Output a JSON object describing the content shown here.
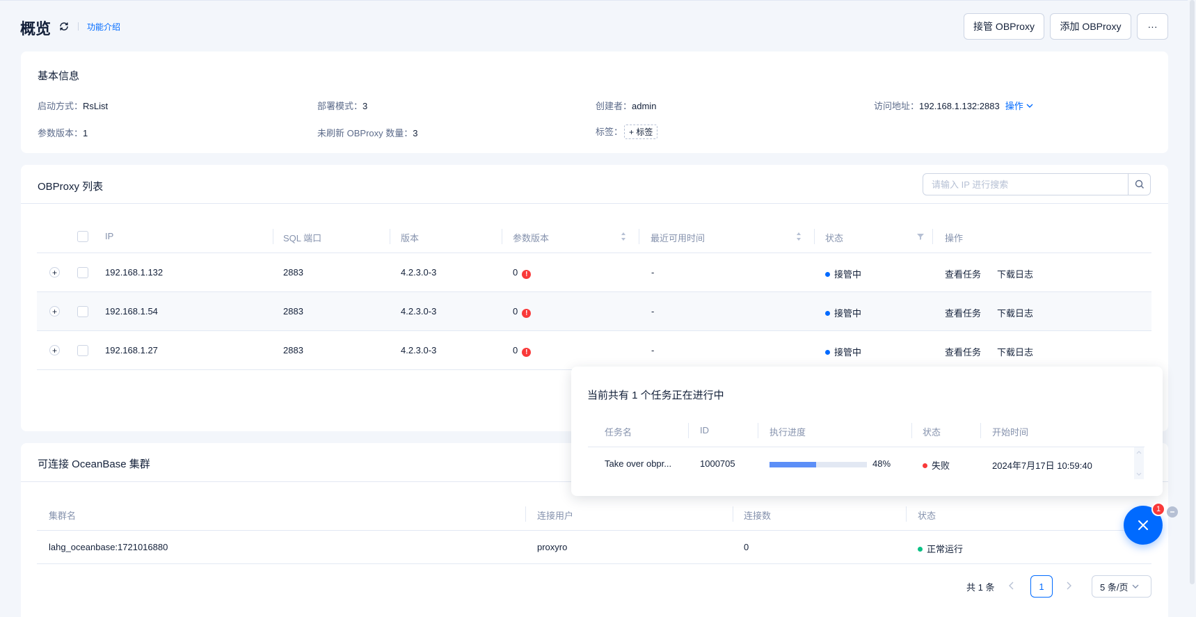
{
  "header": {
    "title": "概览",
    "intro_link": "功能介绍",
    "buttons": {
      "takeover": "接管 OBProxy",
      "add": "添加 OBProxy",
      "more": "···"
    }
  },
  "basic_info": {
    "title": "基本信息",
    "start_mode_label": "启动方式：",
    "start_mode": "RsList",
    "deploy_mode_label": "部署模式：",
    "deploy_mode": "3",
    "creator_label": "创建者：",
    "creator": "admin",
    "address_label": "访问地址：",
    "address": "192.168.1.132:2883",
    "address_action": "操作",
    "param_version_label": "参数版本：",
    "param_version": "1",
    "unrefreshed_label": "未刷新 OBProxy 数量：",
    "unrefreshed": "3",
    "tags_label": "标签：",
    "tag_button": "标签"
  },
  "proxy_list": {
    "title": "OBProxy 列表",
    "search_placeholder": "请输入 IP 进行搜索",
    "columns": {
      "ip": "IP",
      "sql_port": "SQL 端口",
      "version": "版本",
      "param_version": "参数版本",
      "last_available": "最近可用时间",
      "status": "状态",
      "actions": "操作"
    },
    "rows": [
      {
        "ip": "192.168.1.132",
        "port": "2883",
        "version": "4.2.3.0-3",
        "param_version": "0",
        "last_available": "-",
        "status": "接管中",
        "action1": "查看任务",
        "action2": "下载日志"
      },
      {
        "ip": "192.168.1.54",
        "port": "2883",
        "version": "4.2.3.0-3",
        "param_version": "0",
        "last_available": "-",
        "status": "接管中",
        "action1": "查看任务",
        "action2": "下载日志"
      },
      {
        "ip": "192.168.1.27",
        "port": "2883",
        "version": "4.2.3.0-3",
        "param_version": "0",
        "last_available": "-",
        "status": "接管中",
        "action1": "查看任务",
        "action2": "下载日志"
      }
    ],
    "error_mark": "!"
  },
  "clusters": {
    "title": "可连接 OceanBase 集群",
    "columns": {
      "name": "集群名",
      "user": "连接用户",
      "count": "连接数",
      "status": "状态"
    },
    "rows": [
      {
        "name": "lahg_oceanbase:1721016880",
        "user": "proxyro",
        "count": "0",
        "status": "正常运行"
      }
    ],
    "pagination": {
      "total": "共 1 条",
      "page": "1",
      "page_size": "5 条/页"
    }
  },
  "task_popover": {
    "title": "当前共有 1 个任务正在进行中",
    "columns": {
      "name": "任务名",
      "id": "ID",
      "progress": "执行进度",
      "status": "状态",
      "start_time": "开始时间"
    },
    "task": {
      "name": "Take over obpr...",
      "id": "1000705",
      "progress_label": "48%",
      "progress_value": 0.48,
      "status": "失败",
      "start_time": "2024年7月17日 10:59:40"
    }
  },
  "fab": {
    "badge": "1"
  },
  "colors": {
    "accent": "#006aff",
    "error": "#f93939",
    "success": "#0ac185",
    "progress": "#5c8ff7"
  }
}
